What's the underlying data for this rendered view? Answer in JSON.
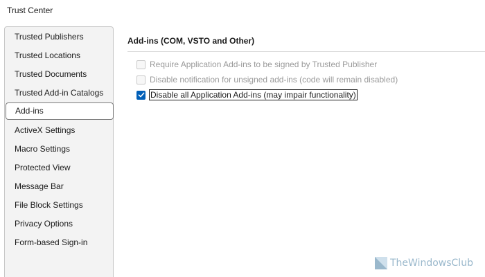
{
  "window": {
    "title": "Trust Center"
  },
  "sidebar": {
    "items": [
      {
        "label": "Trusted Publishers"
      },
      {
        "label": "Trusted Locations"
      },
      {
        "label": "Trusted Documents"
      },
      {
        "label": "Trusted Add-in Catalogs"
      },
      {
        "label": "Add-ins",
        "selected": true
      },
      {
        "label": "ActiveX Settings"
      },
      {
        "label": "Macro Settings"
      },
      {
        "label": "Protected View"
      },
      {
        "label": "Message Bar"
      },
      {
        "label": "File Block Settings"
      },
      {
        "label": "Privacy Options"
      },
      {
        "label": "Form-based Sign-in"
      }
    ]
  },
  "main": {
    "heading": "Add-ins (COM, VSTO and Other)",
    "options": [
      {
        "label": "Require Application Add-ins to be signed by Trusted Publisher",
        "checked": false,
        "enabled": false
      },
      {
        "label": "Disable notification for unsigned add-ins (code will remain disabled)",
        "checked": false,
        "enabled": false
      },
      {
        "label": "Disable all Application Add-ins (may impair functionality)",
        "checked": true,
        "enabled": true
      }
    ]
  },
  "watermark": {
    "text": "TheWindowsClub"
  },
  "colors": {
    "accent": "#005fb8",
    "disabled_text": "#9a9a9a",
    "sidebar_bg": "#f3f3f3"
  }
}
